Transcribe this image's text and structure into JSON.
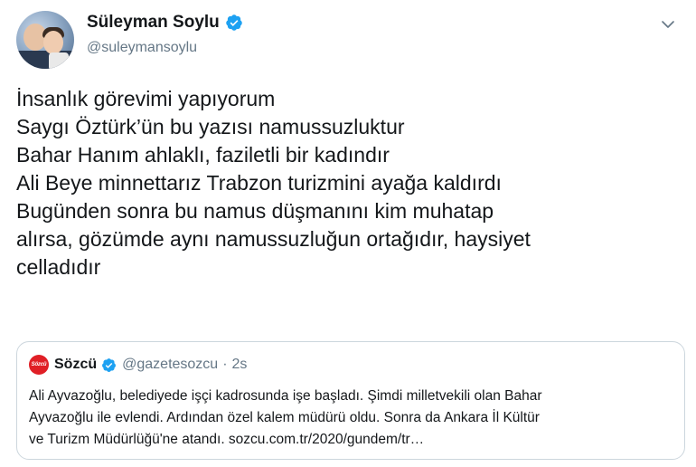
{
  "author": {
    "display_name": "Süleyman Soylu",
    "handle": "@suleymansoylu",
    "verified": true
  },
  "tweet": {
    "lines": [
      "İnsanlık görevimi yapıyorum",
      "Saygı Öztürk’ün bu yazısı namussuzluktur",
      "Bahar Hanım ahlaklı, faziletli bir kadındır",
      "Ali Beye minnettarız Trabzon turizmini ayağa kaldırdı",
      "Bugünden sonra bu namus düşmanını kim muhatap",
      "alırsa, gözümde aynı namussuzluğun ortağıdır, haysiyet",
      "celladıdır"
    ]
  },
  "quote": {
    "logo_text": "Sözcü",
    "display_name": "Sözcü",
    "handle": "@gazetesozcu",
    "separator": "·",
    "time": "2s",
    "lines": [
      "Ali Ayvazoğlu, belediyede işçi kadrosunda işe başladı. Şimdi milletvekili olan Bahar",
      "Ayvazoğlu ile evlendi. Ardından özel kalem müdürü oldu. Sonra da Ankara İl Kültür",
      "ve Turizm Müdürlüğü'ne atandı. sozcu.com.tr/2020/gundem/tr…"
    ]
  },
  "icons": {
    "verified": "verified-badge-icon",
    "menu": "chevron-down-icon"
  },
  "colors": {
    "verified_blue": "#1da1f2",
    "secondary_text": "#657786",
    "border": "#ccd6dd",
    "brand_red": "#e01f26"
  }
}
